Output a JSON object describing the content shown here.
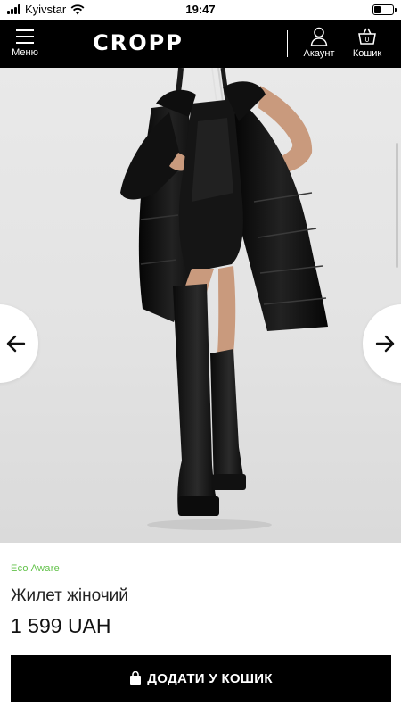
{
  "status_bar": {
    "carrier": "Kyivstar",
    "time": "19:47",
    "battery_level": 0.3
  },
  "header": {
    "menu_label": "Меню",
    "logo_text": "CROPP",
    "account_label": "Акаунт",
    "cart_label": "Кошик"
  },
  "product": {
    "badge": "Eco Aware",
    "name": "Жилет жіночий",
    "price": "1 599 UAH"
  },
  "add_to_cart": {
    "label": "ДОДАТИ У КОШИК"
  },
  "icons": {
    "menu": "hamburger-icon",
    "account": "user-icon",
    "cart": "basket-icon",
    "prev": "arrow-left-icon",
    "next": "arrow-right-icon",
    "bag": "shopping-bag-icon"
  },
  "colors": {
    "header_bg": "#000000",
    "eco_green": "#62c24a",
    "button_bg": "#000000",
    "photo_bg": "#e6e6e6"
  }
}
